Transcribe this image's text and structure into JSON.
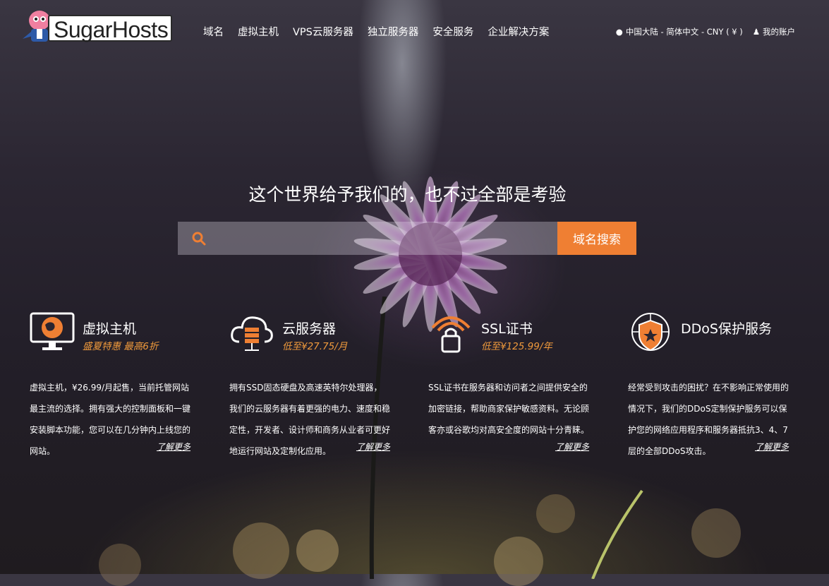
{
  "brand": {
    "name_part1": "Sugar",
    "name_part2": "Hosts"
  },
  "nav": [
    "域名",
    "虚拟主机",
    "VPS云服务器",
    "独立服务器",
    "安全服务",
    "企业解决方案"
  ],
  "util": {
    "region": "中国大陆 - 简体中文 - CNY ( ¥ )",
    "account": "我的账户"
  },
  "hero": {
    "headline": "这个世界给予我们的，也不过全部是考验"
  },
  "search": {
    "placeholder": "",
    "button": "域名搜索"
  },
  "features": [
    {
      "title": "虚拟主机",
      "promo": "盛夏特惠 最高6折",
      "desc": "虚拟主机，¥26.99/月起售，当前托管网站最主流的选择。拥有强大的控制面板和一键安装脚本功能，您可以在几分钟内上线您的网站。",
      "more": "了解更多"
    },
    {
      "title": "云服务器",
      "promo": "低至¥27.75/月",
      "desc": "拥有SSD固态硬盘及高速英特尔处理器，我们的云服务器有着更强的电力、速度和稳定性，开发者、设计师和商务从业者可更好地运行网站及定制化应用。",
      "more": "了解更多"
    },
    {
      "title": "SSL证书",
      "promo": "低至¥125.99/年",
      "desc": "SSL证书在服务器和访问者之间提供安全的加密链接，帮助商家保护敏感资料。无论顾客亦或谷歌均对高安全度的网站十分青睐。",
      "more": "了解更多"
    },
    {
      "title": "DDoS保护服务",
      "promo": "",
      "desc": "经常受到攻击的困扰？在不影响正常使用的情况下，我们的DDoS定制保护服务可以保护您的网络应用程序和服务器抵抗3、4、7层的全部DDoS攻击。",
      "more": "了解更多"
    }
  ],
  "colors": {
    "accent": "#ef7f33",
    "promo": "#f09a3c"
  }
}
